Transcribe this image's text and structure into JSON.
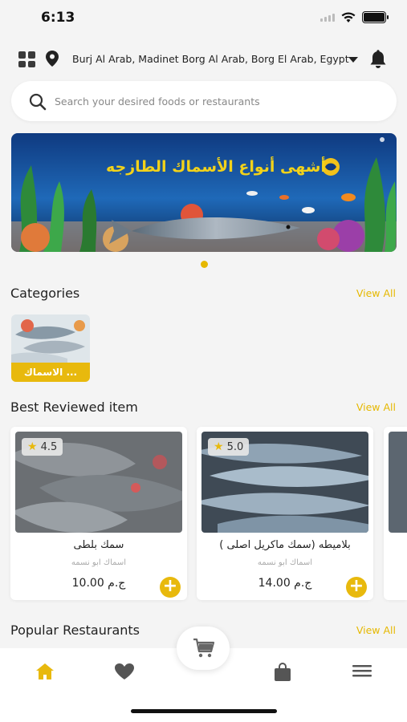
{
  "status_bar": {
    "time": "6:13"
  },
  "header": {
    "location": "Burj Al Arab, Madinet Borg Al Arab, Borg El Arab, Egypt"
  },
  "search": {
    "placeholder": "Search your desired foods or restaurants"
  },
  "banner": {
    "text": "أشهى أنواع الأسماك الطازجه"
  },
  "categories": {
    "title": "Categories",
    "view_all": "View All",
    "items": [
      {
        "label": "الاسماك ..."
      }
    ]
  },
  "best_reviewed": {
    "title": "Best Reviewed item",
    "view_all": "View All",
    "items": [
      {
        "rating": "4.5",
        "name": "سمك بلطى",
        "shop": "اسماك ابو نسمه",
        "price": "ج.م 10.00"
      },
      {
        "rating": "5.0",
        "name": "بلاميطه (سمك ماكريل اصلى )",
        "shop": "اسماك ابو نسمه",
        "price": "ج.م 14.00"
      }
    ]
  },
  "popular_restaurants": {
    "title": "Popular Restaurants",
    "view_all": "View All"
  },
  "colors": {
    "accent": "#e8b90d",
    "background": "#f4f4f4"
  },
  "icons": {
    "nav": [
      "home-icon",
      "heart-icon",
      "cart-icon",
      "bag-icon",
      "menu-icon"
    ]
  }
}
